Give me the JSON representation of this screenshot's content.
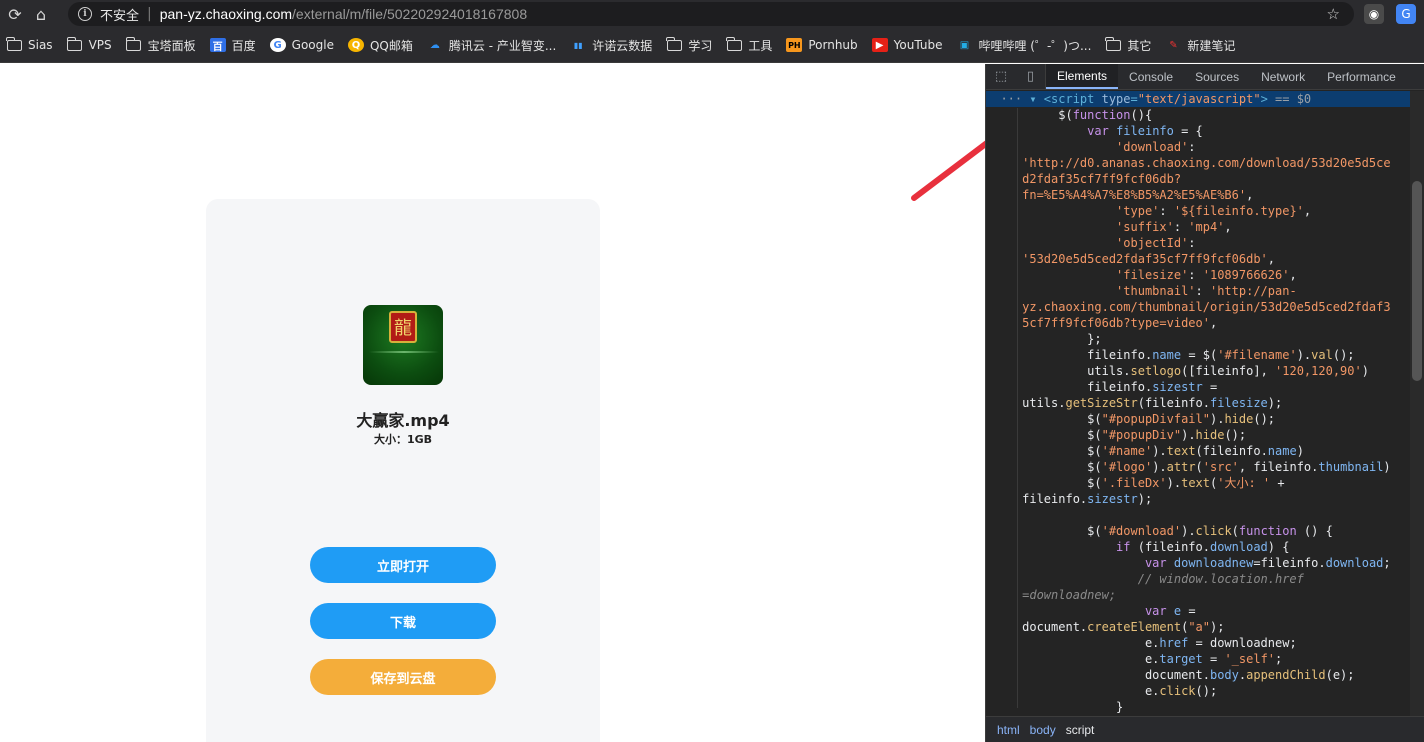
{
  "browser": {
    "insecure_label": "不安全",
    "url_host": "pan-yz.chaoxing.com",
    "url_path": "/external/m/file/502202924018167808"
  },
  "bookmarks": [
    {
      "label": "Sias",
      "icon": "folder-icon"
    },
    {
      "label": "VPS",
      "icon": "folder-icon"
    },
    {
      "label": "宝塔面板",
      "icon": "folder-icon"
    },
    {
      "label": "百度",
      "icon": "baidu-icon"
    },
    {
      "label": "Google",
      "icon": "google-icon"
    },
    {
      "label": "QQ邮箱",
      "icon": "qq-mail-icon"
    },
    {
      "label": "腾讯云 - 产业智变...",
      "icon": "tencent-cloud-icon"
    },
    {
      "label": "许诺云数据",
      "icon": "xunuo-icon"
    },
    {
      "label": "学习",
      "icon": "folder-icon"
    },
    {
      "label": "工具",
      "icon": "folder-icon"
    },
    {
      "label": "Pornhub",
      "icon": "ph-icon"
    },
    {
      "label": "YouTube",
      "icon": "youtube-icon"
    },
    {
      "label": "哔哩哔哩 (゜-゜)つ...",
      "icon": "bilibili-icon"
    },
    {
      "label": "其它",
      "icon": "folder-icon"
    },
    {
      "label": "新建笔记",
      "icon": "note-icon"
    }
  ],
  "file": {
    "name": "大赢家.mp4",
    "size_text": "大小：1GB"
  },
  "buttons": {
    "open": "立即打开",
    "download": "下载",
    "save": "保存到云盘"
  },
  "devtools": {
    "tabs": [
      "Elements",
      "Console",
      "Sources",
      "Network",
      "Performance"
    ],
    "active_tab": "Elements",
    "breadcrumbs": [
      "html",
      "body",
      "script"
    ]
  },
  "colors": {
    "primary_button": "#1f9cf5",
    "save_button": "#f4ad3a",
    "annotation_arrow": "#e8303d"
  }
}
